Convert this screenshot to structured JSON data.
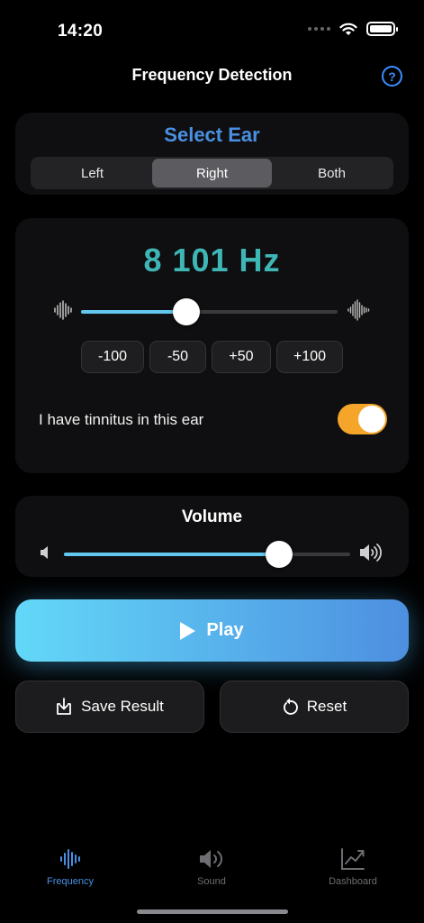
{
  "status_bar": {
    "time": "14:20"
  },
  "nav": {
    "title": "Frequency Detection",
    "help_label": "?"
  },
  "ear_select": {
    "title": "Select Ear",
    "options": [
      "Left",
      "Right",
      "Both"
    ],
    "selected": "Right"
  },
  "frequency": {
    "value_label": "8 101 Hz",
    "slider_fraction": 0.41,
    "steps": [
      "-100",
      "-50",
      "+50",
      "+100"
    ]
  },
  "tinnitus": {
    "label": "I have tinnitus in this ear",
    "enabled": true
  },
  "volume": {
    "title": "Volume",
    "slider_fraction": 0.75
  },
  "actions": {
    "play_label": "Play",
    "save_label": "Save Result",
    "reset_label": "Reset"
  },
  "tab_bar": {
    "tabs": [
      {
        "label": "Frequency",
        "icon": "waveform-icon",
        "active": true
      },
      {
        "label": "Sound",
        "icon": "speaker-icon",
        "active": false
      },
      {
        "label": "Dashboard",
        "icon": "chart-icon",
        "active": false
      }
    ]
  },
  "colors": {
    "accent_blue": "#4a90e2",
    "frequency_teal": "#3fb6b6",
    "slider_fill": "#63c8f0",
    "toggle_on": "#f4a52a",
    "play_gradient_start": "#63d8f8",
    "play_gradient_end": "#4d8fe0"
  }
}
